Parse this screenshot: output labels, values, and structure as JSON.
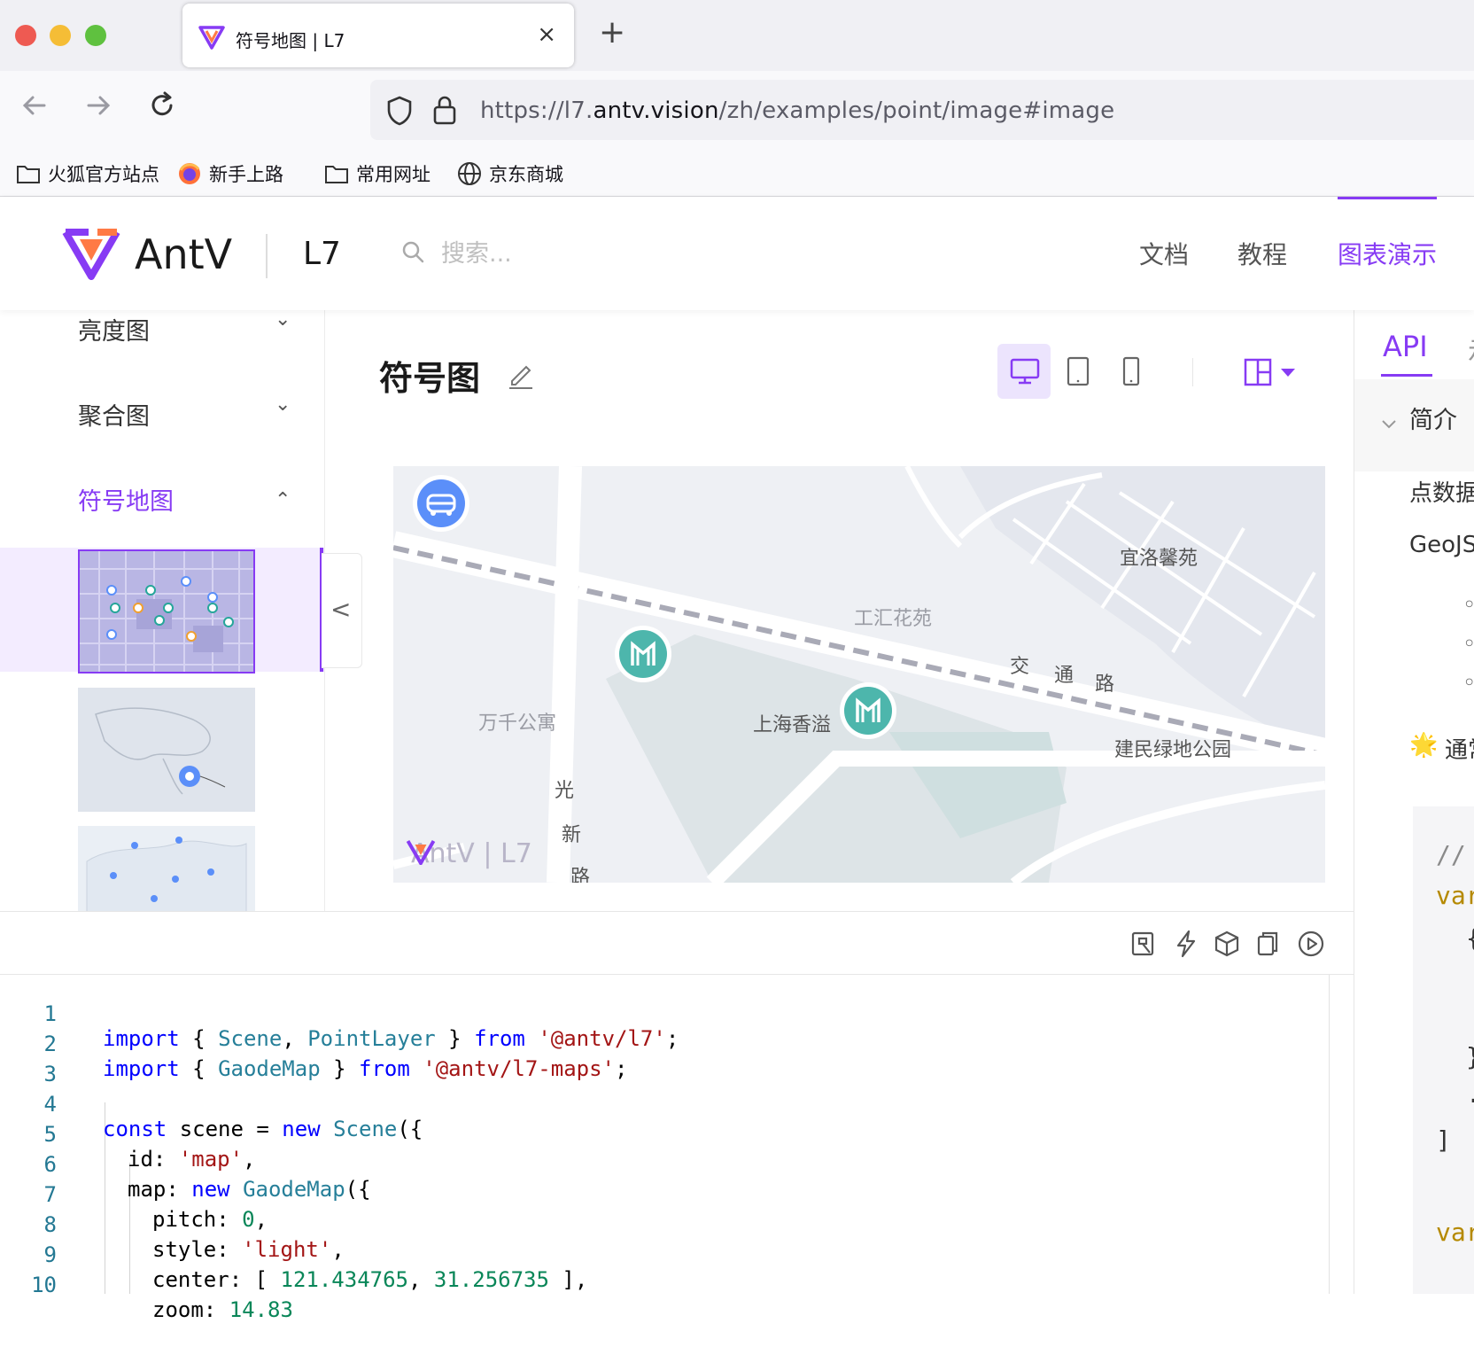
{
  "browser": {
    "tab_title": "符号地图 | L7",
    "tab_close": "×",
    "new_tab": "+",
    "url_prefix": "https://l7.",
    "url_domain": "antv.vision",
    "url_path": "/zh/examples/point/image#image",
    "bookmarks": [
      {
        "label": "火狐官方站点",
        "icon": "folder-icon"
      },
      {
        "label": "新手上路",
        "icon": "firefox-icon"
      },
      {
        "label": "常用网址",
        "icon": "folder-icon"
      },
      {
        "label": "京东商城",
        "icon": "globe-icon"
      }
    ]
  },
  "header": {
    "logo_text": "AntV",
    "product": "L7",
    "search_placeholder": "搜索...",
    "nav": {
      "docs": "文档",
      "tutorial": "教程",
      "examples": "图表演示"
    },
    "accent_color": "#873bf4"
  },
  "sidebar": {
    "items": [
      {
        "label": "亮度图",
        "chevron": "⌄"
      },
      {
        "label": "聚合图",
        "chevron": "⌄"
      },
      {
        "label": "符号地图",
        "chevron": "⌃",
        "active": true
      }
    ]
  },
  "demo": {
    "title": "符号图",
    "collapse_glyph": "<"
  },
  "map": {
    "labels": {
      "yiluo": "宜洛馨苑",
      "gonghui": "工汇花苑",
      "jiao": "交",
      "tong": "通",
      "lu": "路",
      "wanqian": "万千公寓",
      "shanghai": "上海香溢",
      "jianmin": "建民绿地公园",
      "guang": "光",
      "xin": "新",
      "lu2": "路"
    },
    "watermark_brand": "AntV | L7",
    "marker_colors": {
      "car": "#5b8ff9",
      "metro": "#4db6ac"
    }
  },
  "editor": {
    "lines": [
      {
        "n": "1"
      },
      {
        "n": "2"
      },
      {
        "n": "3"
      },
      {
        "n": "4"
      },
      {
        "n": "5"
      },
      {
        "n": "6"
      },
      {
        "n": "7"
      },
      {
        "n": "8"
      },
      {
        "n": "9"
      },
      {
        "n": "10"
      }
    ],
    "tokens": {
      "import": "import",
      "from": "from",
      "const": "const",
      "new": "new",
      "l1_open": " { ",
      "scene": "Scene",
      "comma": ", ",
      "pointlayer": "PointLayer",
      "l1_close": " } ",
      "pkg1": "'@antv/l7'",
      "semi": ";",
      "gaodemap": "GaodeMap",
      "pkg2": "'@antv/l7-maps'",
      "l4_mid": " scene = ",
      "l4_end": "({",
      "id_key": "id: ",
      "id_val": "'map'",
      "trail_comma": ",",
      "map_key": "map: ",
      "pitch_key": "pitch: ",
      "pitch_val": "0",
      "style_key": "style: ",
      "style_val": "'light'",
      "center_key": "center: [ ",
      "lng": "121.434765",
      "lat": "31.256735",
      "center_end": " ],",
      "zoom_key": "zoom: ",
      "zoom_val": "14.83"
    }
  },
  "api_panel": {
    "tab": "API",
    "tab_more": "示",
    "intro": "简介",
    "line1": "点数据",
    "line2": "GeoJSON",
    "bullet": "◦",
    "tip_icon": "🌟",
    "tip_text": "通常",
    "code_comment": "// ",
    "code_var": "var",
    "code_brace": "{",
    "code_close": "}",
    "code_dot": ".",
    "code_bracket": "]"
  }
}
